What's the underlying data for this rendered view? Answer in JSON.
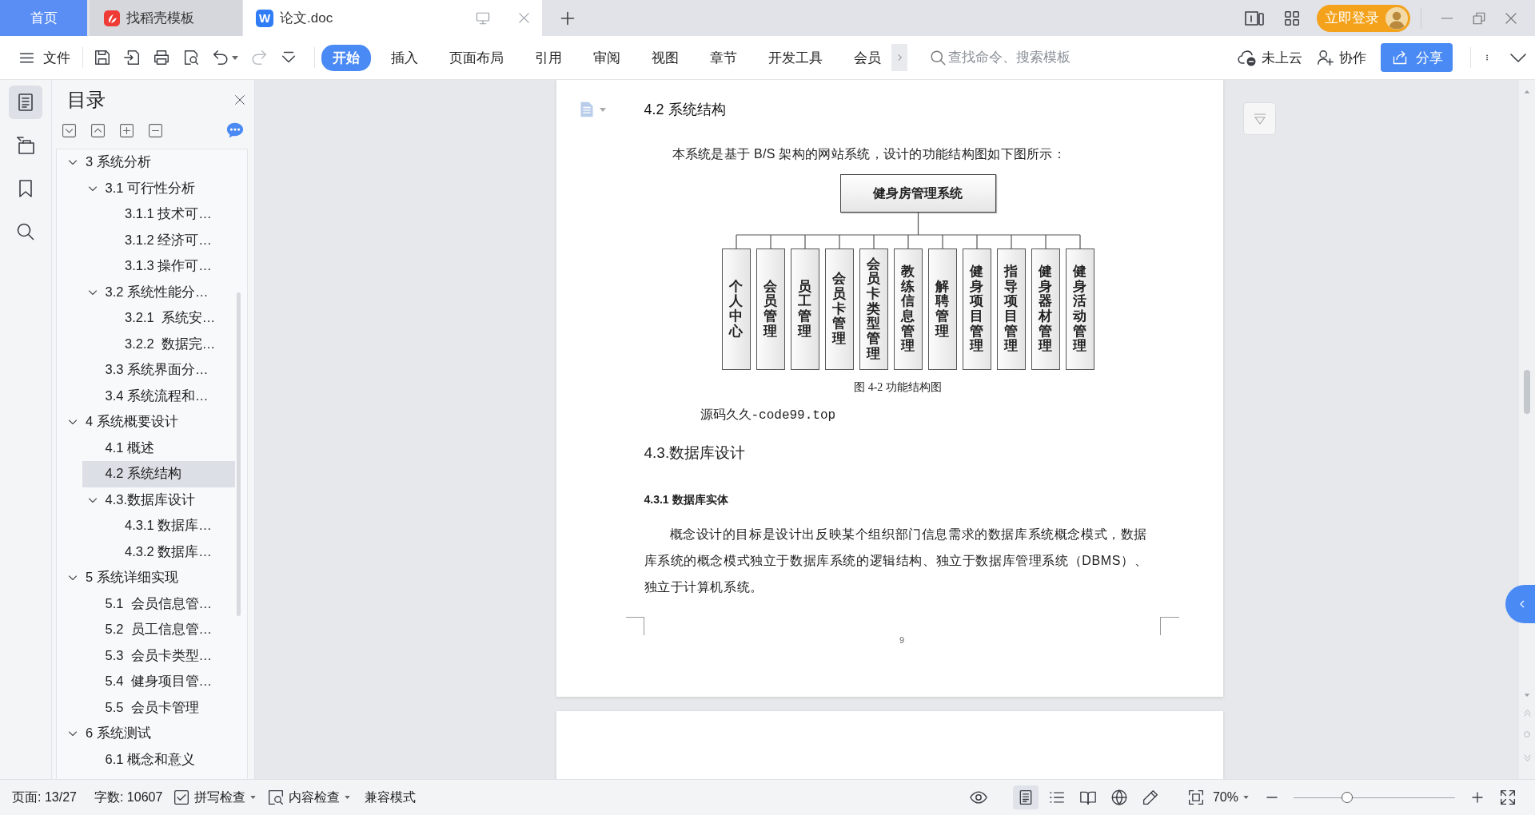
{
  "tab_bar": {
    "tabs": [
      {
        "kind": "home",
        "label": "首页",
        "selected": false
      },
      {
        "kind": "template",
        "label": "找稻壳模板",
        "selected": false
      },
      {
        "kind": "document",
        "label": "论文.doc",
        "app_letter": "W",
        "selected": true
      }
    ],
    "login_button": "立即登录"
  },
  "toolbar": {
    "file_menu": "文件",
    "quick_actions": [
      {
        "kind": "save",
        "disabled": false
      },
      {
        "kind": "export",
        "disabled": false
      },
      {
        "kind": "print",
        "disabled": false
      },
      {
        "kind": "preview",
        "disabled": false
      },
      {
        "kind": "undo",
        "disabled": false
      },
      {
        "kind": "redo",
        "disabled": true
      },
      {
        "kind": "customize",
        "disabled": false
      }
    ],
    "ribbon_tabs": [
      {
        "label": "开始",
        "selected": true
      },
      {
        "label": "插入",
        "selected": false
      },
      {
        "label": "页面布局",
        "selected": false
      },
      {
        "label": "引用",
        "selected": false
      },
      {
        "label": "审阅",
        "selected": false
      },
      {
        "label": "视图",
        "selected": false
      },
      {
        "label": "章节",
        "selected": false
      },
      {
        "label": "开发工具",
        "selected": false
      },
      {
        "label": "会员",
        "selected": false
      }
    ],
    "search": {
      "placeholder": "查找命令、搜索模板"
    },
    "cloud_status": "未上云",
    "collaborate": "协作",
    "share_button": "分享"
  },
  "side_rail": [
    {
      "kind": "outline",
      "selected": true
    },
    {
      "kind": "chapters",
      "selected": false
    },
    {
      "kind": "bookmarks",
      "selected": false
    },
    {
      "kind": "search",
      "selected": false
    }
  ],
  "side_panel": {
    "title": "目录",
    "outline": [
      {
        "label": "3 系统分析",
        "selected": false,
        "expanded": true,
        "children": [
          {
            "label": "3.1 可行性分析",
            "selected": false,
            "expanded": true,
            "children": [
              {
                "label": "3.1.1 技术可…",
                "selected": false
              },
              {
                "label": "3.1.2 经济可…",
                "selected": false
              },
              {
                "label": "3.1.3 操作可…",
                "selected": false
              }
            ]
          },
          {
            "label": "3.2 系统性能分…",
            "selected": false,
            "expanded": true,
            "children": [
              {
                "label": "3.2.1  系统安…",
                "selected": false
              },
              {
                "label": "3.2.2  数据完…",
                "selected": false
              }
            ]
          },
          {
            "label": "3.3 系统界面分…",
            "selected": false
          },
          {
            "label": "3.4 系统流程和…",
            "selected": false
          }
        ]
      },
      {
        "label": "4 系统概要设计",
        "selected": false,
        "expanded": true,
        "children": [
          {
            "label": "4.1 概述",
            "selected": false
          },
          {
            "label": "4.2 系统结构",
            "selected": true
          },
          {
            "label": "4.3.数据库设计",
            "selected": false,
            "expanded": true,
            "children": [
              {
                "label": "4.3.1 数据库…",
                "selected": false
              },
              {
                "label": "4.3.2 数据库…",
                "selected": false
              }
            ]
          }
        ]
      },
      {
        "label": "5 系统详细实现",
        "selected": false,
        "expanded": true,
        "children": [
          {
            "label": "5.1  会员信息管…",
            "selected": false
          },
          {
            "label": "5.2  员工信息管…",
            "selected": false
          },
          {
            "label": "5.3  会员卡类型…",
            "selected": false
          },
          {
            "label": "5.4  健身项目管…",
            "selected": false
          },
          {
            "label": "5.5  会员卡管理",
            "selected": false
          }
        ]
      },
      {
        "label": "6 系统测试",
        "selected": false,
        "expanded": true,
        "children": [
          {
            "label": "6.1 概念和意义",
            "selected": false
          }
        ]
      }
    ]
  },
  "document": {
    "heading": "4.2 系统结构",
    "intro": "本系统是基于 B/S 架构的网站系统，设计的功能结构图如下图所示：",
    "diagram": {
      "root": "健身房管理系统",
      "modules": [
        "个人中心",
        "会员管理",
        "员工管理",
        "会员卡管理",
        "会员卡类型管理",
        "教练信息管理",
        "解聘管理",
        "健身项目管理",
        "指导项目管理",
        "健身器材管理",
        "健身活动管理"
      ]
    },
    "caption": "图 4-2 功能结构图",
    "source_note": "源码久久-code99.top",
    "section_heading": "4.3.数据库设计",
    "subsection_heading": "4.3.1 数据库实体",
    "paragraph": "概念设计的目标是设计出反映某个组织部门信息需求的数据库系统概念模式，数据库系统的概念模式独立于数据库系统的逻辑结构、独立于数据库管理系统（DBMS）、独立于计算机系统。",
    "page_number": "9"
  },
  "status_bar": {
    "page_info": "页面: 13/27",
    "word_count": "字数: 10607",
    "spell_check": "拼写检查",
    "content_check": "内容检查",
    "compat_mode": "兼容模式",
    "view_modes": [
      {
        "kind": "page",
        "selected": true
      },
      {
        "kind": "outline",
        "selected": false
      },
      {
        "kind": "reading",
        "selected": false
      },
      {
        "kind": "web",
        "selected": false
      },
      {
        "kind": "writing",
        "selected": false
      }
    ],
    "zoom": "70%",
    "zoom_slider": {
      "level": 0.33
    }
  }
}
